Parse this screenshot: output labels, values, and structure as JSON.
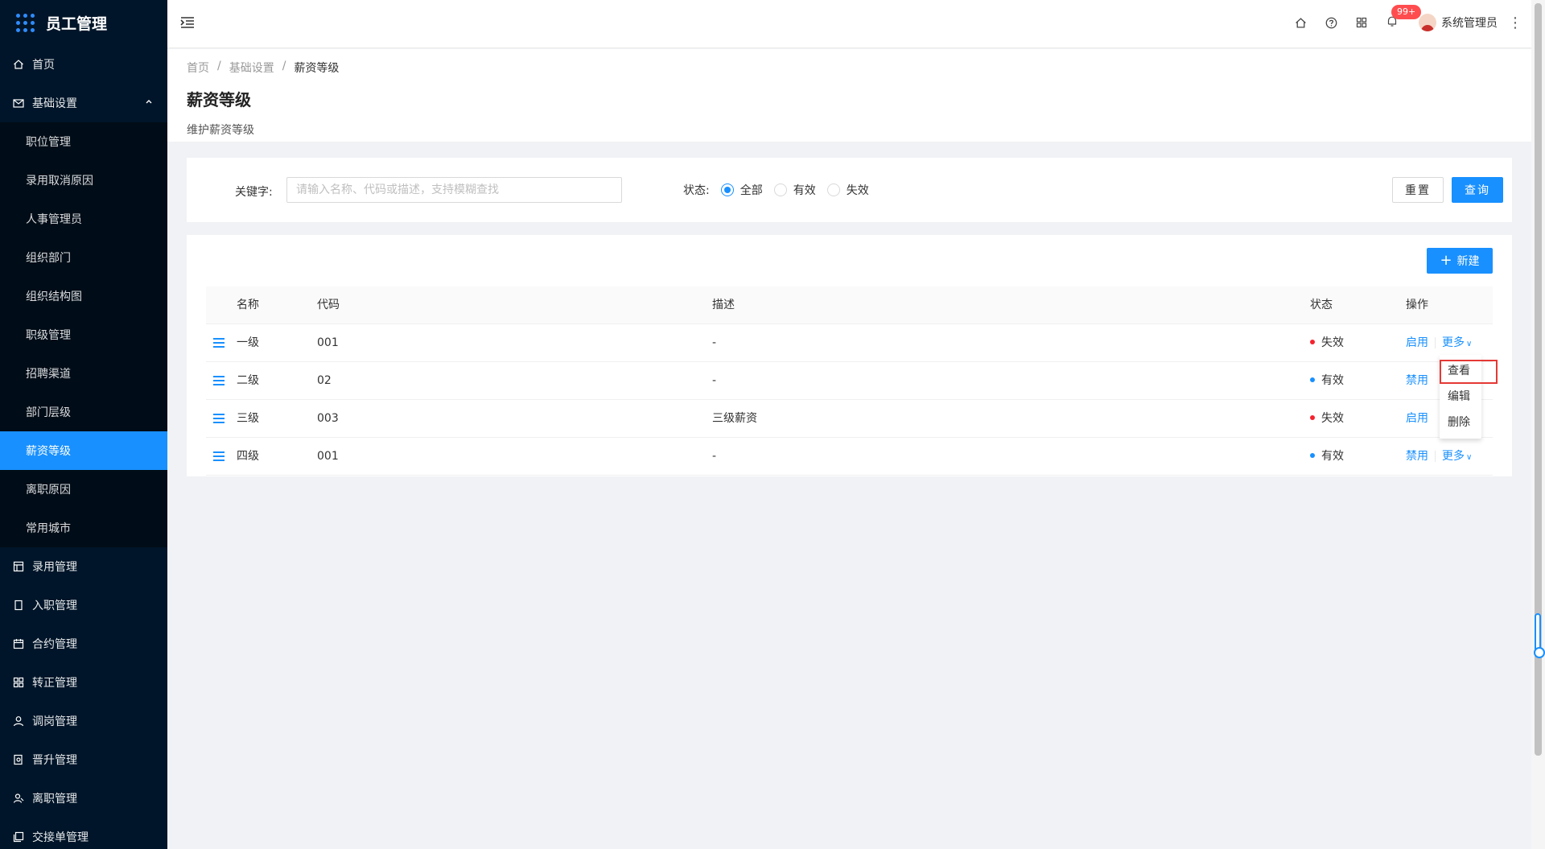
{
  "app": {
    "title": "员工管理"
  },
  "sidebar": {
    "home": "首页",
    "group": "基础设置",
    "sub_items": [
      "职位管理",
      "录用取消原因",
      "人事管理员",
      "组织部门",
      "组织结构图",
      "职级管理",
      "招聘渠道",
      "部门层级",
      "薪资等级",
      "离职原因",
      "常用城市"
    ],
    "active_sub": "薪资等级",
    "bottom_items": [
      "录用管理",
      "入职管理",
      "合约管理",
      "转正管理",
      "调岗管理",
      "晋升管理",
      "离职管理",
      "交接单管理"
    ]
  },
  "header": {
    "badge": "99+",
    "user_name": "系统管理员"
  },
  "breadcrumb": [
    "首页",
    "基础设置",
    "薪资等级"
  ],
  "page": {
    "title": "薪资等级",
    "description": "维护薪资等级"
  },
  "search": {
    "keyword_label": "关键字:",
    "keyword_value": "",
    "keyword_placeholder": "请输入名称、代码或描述，支持模糊查找",
    "status_label": "状态:",
    "status_options": [
      "全部",
      "有效",
      "失效"
    ],
    "status_selected": "全部",
    "reset_label": "重置",
    "query_label": "查询"
  },
  "table": {
    "new_label": "新建",
    "columns": [
      "名称",
      "代码",
      "描述",
      "状态",
      "操作"
    ],
    "rows": [
      {
        "name": "一级",
        "code": "001",
        "desc": "-",
        "status": "失效",
        "action": "启用",
        "more": "更多"
      },
      {
        "name": "二级",
        "code": "02",
        "desc": "-",
        "status": "有效",
        "action": "禁用",
        "more": ""
      },
      {
        "name": "三级",
        "code": "003",
        "desc": "三级薪资",
        "status": "失效",
        "action": "启用",
        "more": ""
      },
      {
        "name": "四级",
        "code": "001",
        "desc": "-",
        "status": "有效",
        "action": "禁用",
        "more": "更多"
      }
    ],
    "status_colors": {
      "有效": "#1890ff",
      "失效": "#f5222d"
    }
  },
  "dropdown": {
    "items": [
      "查看",
      "编辑",
      "删除"
    ],
    "highlighted": "查看"
  }
}
